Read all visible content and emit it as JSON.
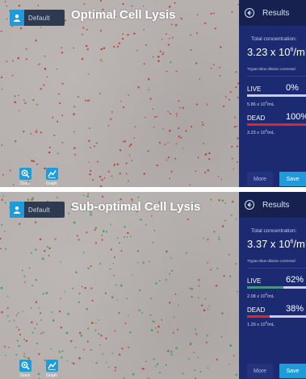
{
  "panels": [
    {
      "user_label": "Default",
      "title": "Optimal Cell Lysis",
      "tools": {
        "zoom_label": "Zoom",
        "graph_label": "Graph"
      },
      "results": {
        "header": "Results",
        "total_label": "Total concentration:",
        "total_mantissa": "3.23 x 10",
        "total_exp": "6",
        "total_unit": "/mL",
        "dilution_note": "Trypan Blue dilution corrected",
        "live": {
          "label": "LIVE",
          "percent_text": "0%",
          "percent": 0,
          "conc_mantissa": "5.86 x 10",
          "conc_exp": "3",
          "conc_unit": "/mL",
          "color": "#22b14c"
        },
        "dead": {
          "label": "DEAD",
          "percent_text": "100%",
          "percent": 100,
          "conc_mantissa": "3.23 x 10",
          "conc_exp": "6",
          "conc_unit": "/mL",
          "color": "#e0262d"
        },
        "more_label": "More",
        "save_label": "Save"
      },
      "cells": {
        "red_count": 260,
        "green_count": 3,
        "seed": 17
      }
    },
    {
      "user_label": "Default",
      "title": "Sub-optimal Cell Lysis",
      "tools": {
        "zoom_label": "Zoom",
        "graph_label": "Graph"
      },
      "results": {
        "header": "Results",
        "total_label": "Total concentration:",
        "total_mantissa": "3.37 x 10",
        "total_exp": "6",
        "total_unit": "/mL",
        "dilution_note": "Trypan Blue dilution corrected",
        "live": {
          "label": "LIVE",
          "percent_text": "62%",
          "percent": 62,
          "conc_mantissa": "2.08 x 10",
          "conc_exp": "6",
          "conc_unit": "/mL",
          "color": "#22b14c"
        },
        "dead": {
          "label": "DEAD",
          "percent_text": "38%",
          "percent": 38,
          "conc_mantissa": "1.29 x 10",
          "conc_exp": "6",
          "conc_unit": "/mL",
          "color": "#e0262d"
        },
        "more_label": "More",
        "save_label": "Save"
      },
      "cells": {
        "red_count": 140,
        "green_count": 170,
        "seed": 91
      }
    }
  ],
  "colors": {
    "accent": "#1e9bd8",
    "panel_bg": "#1c2a72",
    "panel_header_bg": "#16214f",
    "image_bg": "#b6b0ae",
    "live_cell": "#3fa34d",
    "dead_cell": "#c0392b"
  },
  "icons": {
    "user": "user-icon",
    "back": "back-arrow-icon",
    "zoom": "zoom-icon",
    "graph": "graph-icon"
  }
}
